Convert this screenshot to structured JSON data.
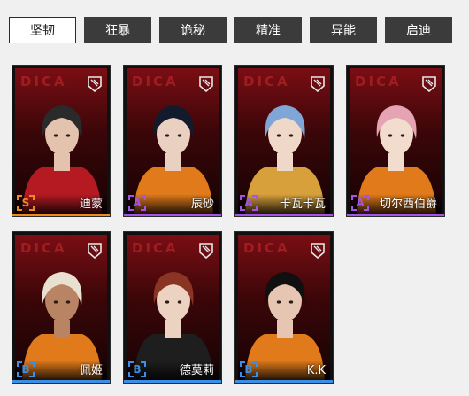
{
  "tabs": [
    {
      "label": "坚韧",
      "active": true
    },
    {
      "label": "狂暴",
      "active": false
    },
    {
      "label": "诡秘",
      "active": false
    },
    {
      "label": "精准",
      "active": false
    },
    {
      "label": "异能",
      "active": false
    },
    {
      "label": "启迪",
      "active": false
    }
  ],
  "characters": [
    {
      "name": "迪蒙",
      "rank": "S",
      "rank_color": "#f08a1c",
      "hair": "#2a2a2a",
      "outfit": "#b51a22",
      "skin": "#e3c3ad",
      "card_logo": "DICA",
      "emblem": "shield-badge-icon"
    },
    {
      "name": "辰砂",
      "rank": "A",
      "rank_color": "#a455e8",
      "hair": "#141a2e",
      "outfit": "#e07a1a",
      "skin": "#e9d0c0",
      "card_logo": "DICA",
      "emblem": "shield-badge-icon"
    },
    {
      "name": "卡瓦卡瓦",
      "rank": "A",
      "rank_color": "#a455e8",
      "hair": "#7fa6d6",
      "outfit": "#d8a03a",
      "skin": "#f0d8c8",
      "card_logo": "DICA",
      "emblem": "shield-badge-icon"
    },
    {
      "name": "切尔西伯爵",
      "rank": "A",
      "rank_color": "#a455e8",
      "hair": "#e6a3b4",
      "outfit": "#e07a1a",
      "skin": "#f2dccd",
      "card_logo": "DICA",
      "emblem": "shield-badge-icon"
    },
    {
      "name": "佩姬",
      "rank": "B",
      "rank_color": "#3b8fe6",
      "hair": "#e8e0d0",
      "outfit": "#e07a1a",
      "skin": "#b98463",
      "card_logo": "DICA",
      "emblem": "shield-badge-icon"
    },
    {
      "name": "德莫莉",
      "rank": "B",
      "rank_color": "#3b8fe6",
      "hair": "#8a3524",
      "outfit": "#1e1e1e",
      "skin": "#ecd2c0",
      "card_logo": "DICA",
      "emblem": "shield-badge-icon"
    },
    {
      "name": "K.K",
      "rank": "B",
      "rank_color": "#3b8fe6",
      "hair": "#101010",
      "outfit": "#e07a1a",
      "skin": "#e6c6b2",
      "card_logo": "DICA",
      "emblem": "shield-badge-icon"
    }
  ]
}
